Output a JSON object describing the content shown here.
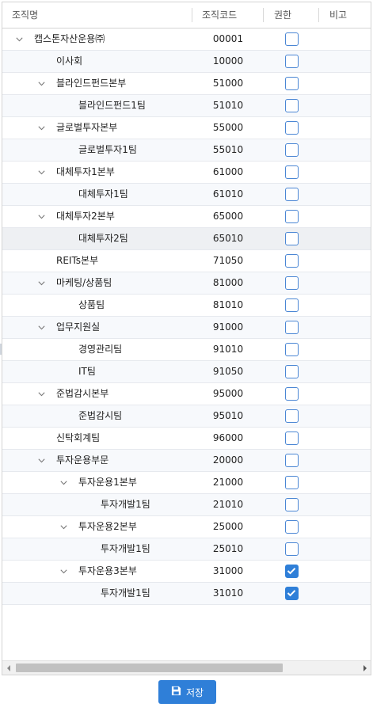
{
  "columns": {
    "name": "조직명",
    "code": "조직코드",
    "permission": "권한",
    "note": "비고"
  },
  "rows": [
    {
      "name": "캡스톤자산운용㈜",
      "code": "00001",
      "level": 0,
      "expandable": true,
      "checked": false
    },
    {
      "name": "이사회",
      "code": "10000",
      "level": 1,
      "expandable": false,
      "checked": false
    },
    {
      "name": "블라인드펀드본부",
      "code": "51000",
      "level": 1,
      "expandable": true,
      "checked": false
    },
    {
      "name": "블라인드펀드1팀",
      "code": "51010",
      "level": 2,
      "expandable": false,
      "checked": false
    },
    {
      "name": "글로벌투자본부",
      "code": "55000",
      "level": 1,
      "expandable": true,
      "checked": false
    },
    {
      "name": "글로벌투자1팀",
      "code": "55010",
      "level": 2,
      "expandable": false,
      "checked": false
    },
    {
      "name": "대체투자1본부",
      "code": "61000",
      "level": 1,
      "expandable": true,
      "checked": false
    },
    {
      "name": "대체투자1팀",
      "code": "61010",
      "level": 2,
      "expandable": false,
      "checked": false
    },
    {
      "name": "대체투자2본부",
      "code": "65000",
      "level": 1,
      "expandable": true,
      "checked": false
    },
    {
      "name": "대체투자2팀",
      "code": "65010",
      "level": 2,
      "expandable": false,
      "checked": false,
      "selected": true
    },
    {
      "name": "REITs본부",
      "code": "71050",
      "level": 1,
      "expandable": false,
      "checked": false
    },
    {
      "name": "마케팅/상품팀",
      "code": "81000",
      "level": 1,
      "expandable": true,
      "checked": false
    },
    {
      "name": "상품팀",
      "code": "81010",
      "level": 2,
      "expandable": false,
      "checked": false
    },
    {
      "name": "업무지원실",
      "code": "91000",
      "level": 1,
      "expandable": true,
      "checked": false
    },
    {
      "name": "경영관리팀",
      "code": "91010",
      "level": 2,
      "expandable": false,
      "checked": false
    },
    {
      "name": "IT팀",
      "code": "91050",
      "level": 2,
      "expandable": false,
      "checked": false
    },
    {
      "name": "준법감시본부",
      "code": "95000",
      "level": 1,
      "expandable": true,
      "checked": false
    },
    {
      "name": "준법감시팀",
      "code": "95010",
      "level": 2,
      "expandable": false,
      "checked": false
    },
    {
      "name": "신탁회계팀",
      "code": "96000",
      "level": 1,
      "expandable": false,
      "checked": false
    },
    {
      "name": "투자운용부문",
      "code": "20000",
      "level": 1,
      "expandable": true,
      "checked": false
    },
    {
      "name": "투자운용1본부",
      "code": "21000",
      "level": 2,
      "expandable": true,
      "checked": false
    },
    {
      "name": "투자개발1팀",
      "code": "21010",
      "level": 3,
      "expandable": false,
      "checked": false
    },
    {
      "name": "투자운용2본부",
      "code": "25000",
      "level": 2,
      "expandable": true,
      "checked": false
    },
    {
      "name": "투자개발1팀",
      "code": "25010",
      "level": 3,
      "expandable": false,
      "checked": false
    },
    {
      "name": "투자운용3본부",
      "code": "31000",
      "level": 2,
      "expandable": true,
      "checked": true
    },
    {
      "name": "투자개발1팀",
      "code": "31010",
      "level": 3,
      "expandable": false,
      "checked": true
    }
  ],
  "save_button": {
    "label": "저장",
    "icon": "floppy-disk-icon"
  },
  "colors": {
    "accent": "#2f7fd8",
    "checkbox_border": "#4a86d4",
    "alt_row": "#f7f9fc",
    "selected_row": "#eef0f3"
  }
}
